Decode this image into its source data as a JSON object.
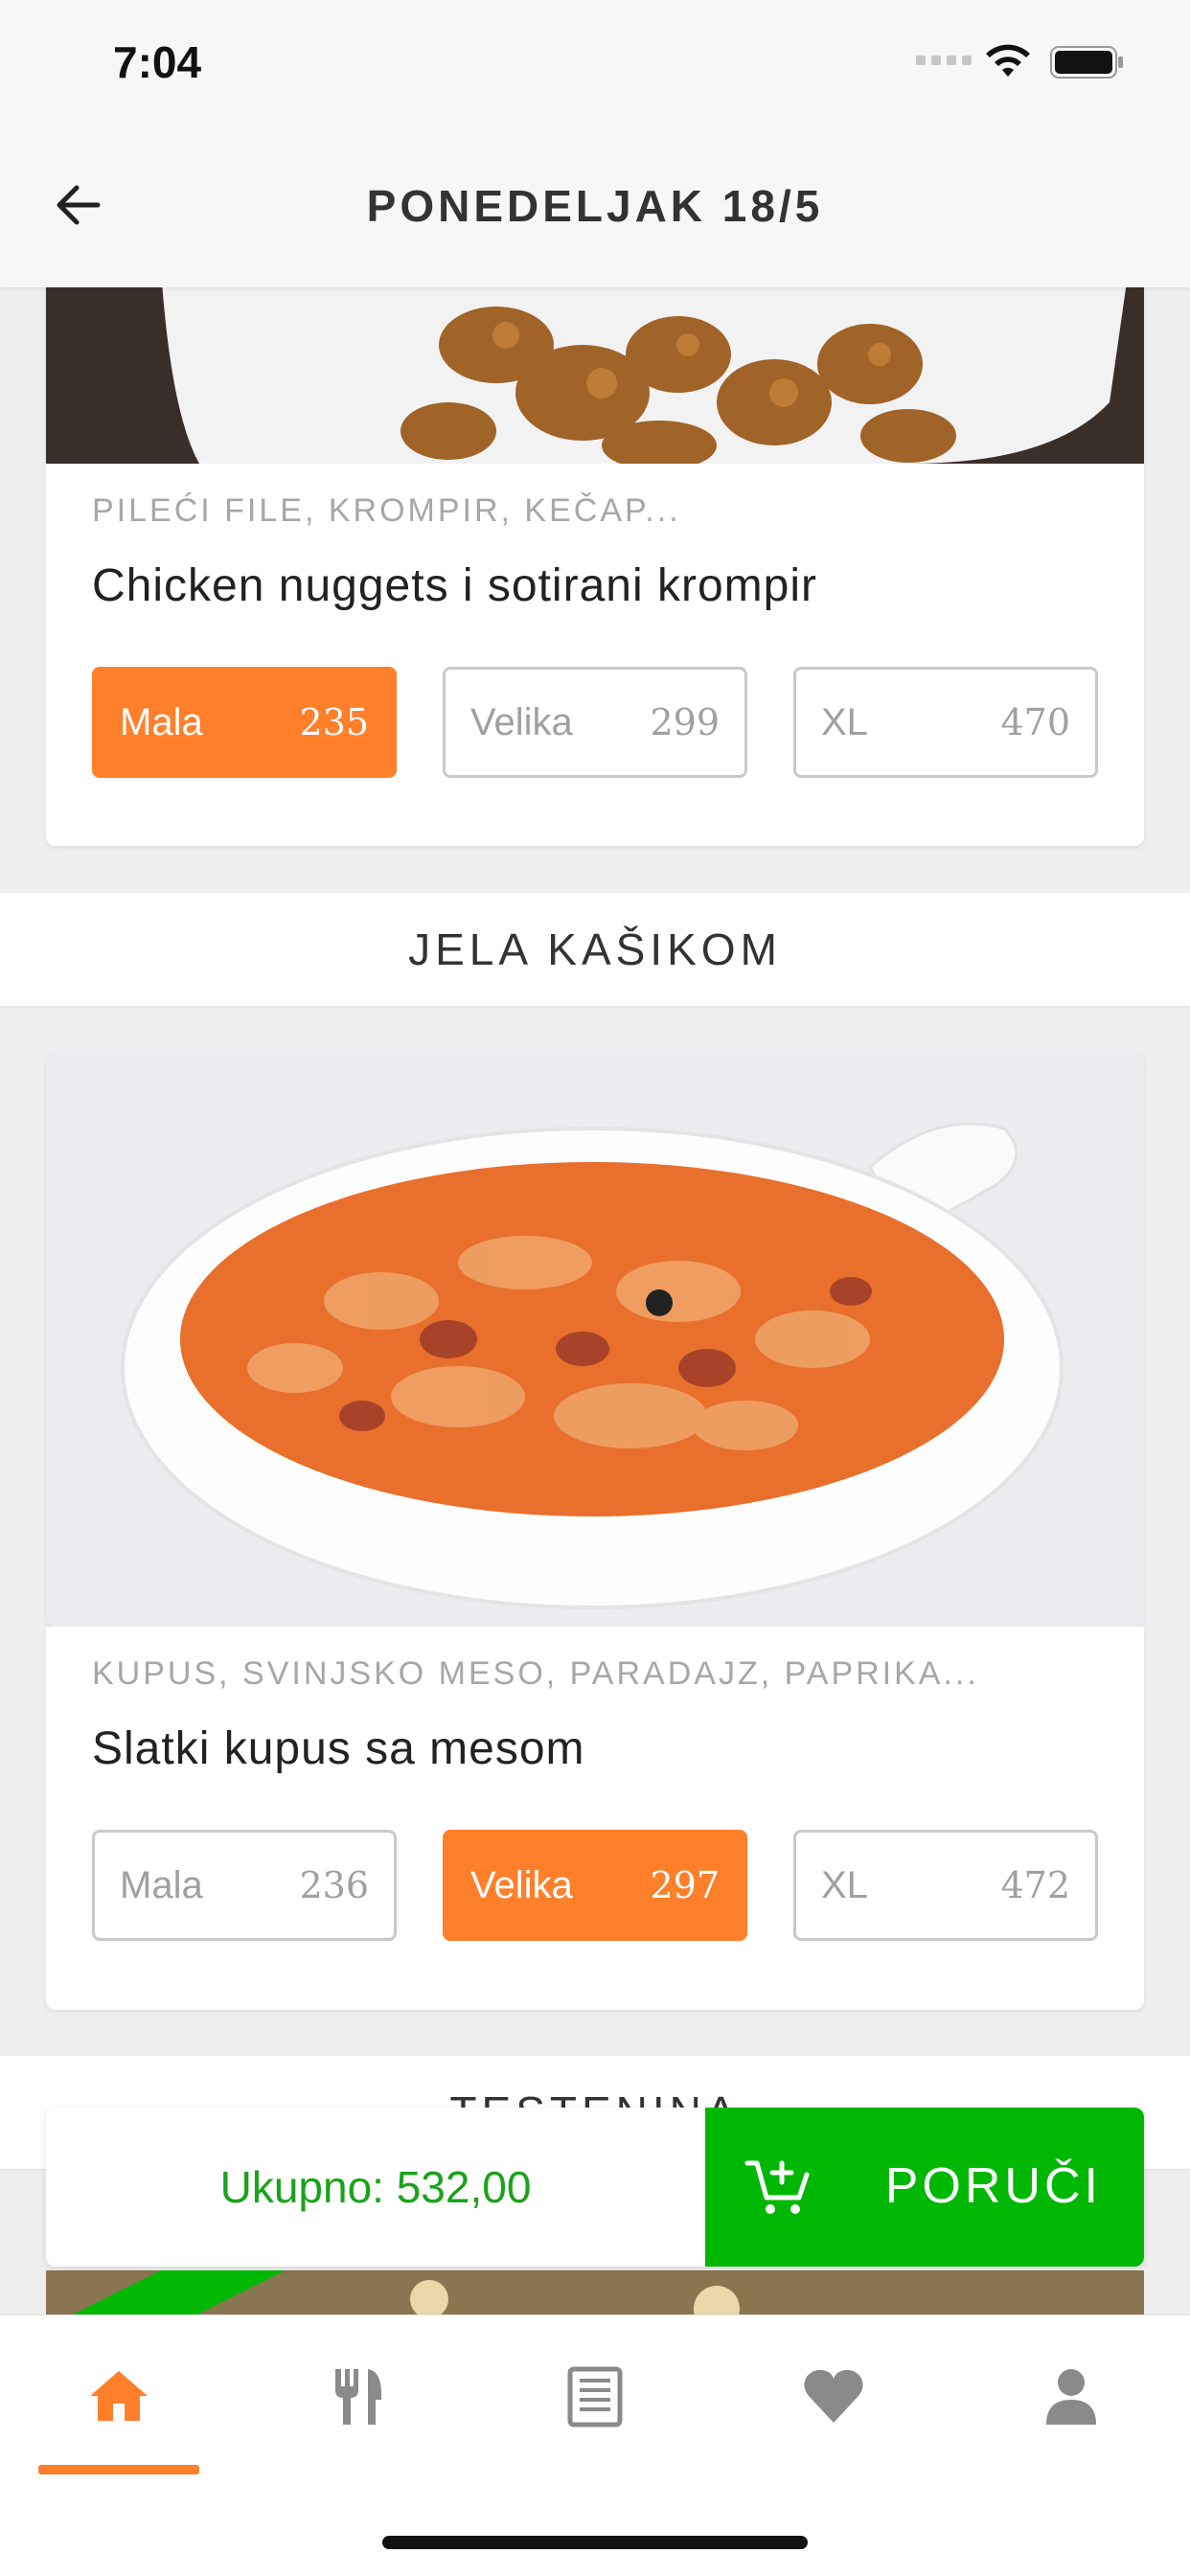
{
  "status": {
    "time": "7:04"
  },
  "header": {
    "title": "PONEDELJAK 18/5"
  },
  "cards": [
    {
      "ingredients": "PILEĆI FILE, KROMPIR, KEČAP...",
      "name": "Chicken nuggets i sotirani krompir",
      "sizes": [
        {
          "label": "Mala",
          "price": "235",
          "selected": true
        },
        {
          "label": "Velika",
          "price": "299",
          "selected": false
        },
        {
          "label": "XL",
          "price": "470",
          "selected": false
        }
      ]
    },
    {
      "ingredients": "KUPUS, SVINJSKO MESO, PARADAJZ, PAPRIKA...",
      "name": "Slatki kupus sa mesom",
      "sizes": [
        {
          "label": "Mala",
          "price": "236",
          "selected": false
        },
        {
          "label": "Velika",
          "price": "297",
          "selected": true
        },
        {
          "label": "XL",
          "price": "472",
          "selected": false
        }
      ]
    }
  ],
  "sections": [
    "JELA KAŠIKOM",
    "TESTENINA"
  ],
  "order": {
    "total_label": "Ukupno: 532,00",
    "button_label": "PORUČI"
  },
  "tabs": [
    {
      "name": "home-icon",
      "active": true
    },
    {
      "name": "fork-knife-icon",
      "active": false
    },
    {
      "name": "menu-list-icon",
      "active": false
    },
    {
      "name": "heart-icon",
      "active": false
    },
    {
      "name": "profile-icon",
      "active": false
    }
  ],
  "colors": {
    "accent": "#ff7f2a",
    "order_green": "#00b803",
    "total_green": "#1aa31a"
  }
}
